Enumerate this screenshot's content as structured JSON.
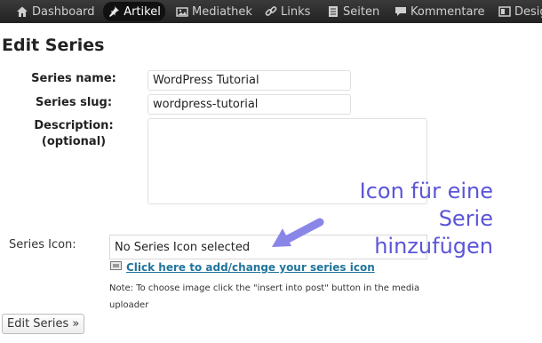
{
  "adminbar": {
    "items": [
      {
        "label": "Dashboard",
        "icon": "home-icon"
      },
      {
        "label": "Artikel",
        "icon": "pin-icon",
        "active": true
      },
      {
        "label": "Mediathek",
        "icon": "media-icon"
      },
      {
        "label": "Links",
        "icon": "link-icon"
      },
      {
        "label": "Seiten",
        "icon": "page-icon"
      },
      {
        "label": "Kommentare",
        "icon": "comment-icon"
      },
      {
        "label": "Design",
        "icon": "design-icon"
      }
    ]
  },
  "page": {
    "title": "Edit Series"
  },
  "form": {
    "name_label": "Series name:",
    "name_value": "WordPress Tutorial",
    "slug_label": "Series slug:",
    "slug_value": "wordpress-tutorial",
    "description_label_line1": "Description:",
    "description_label_line2": "(optional)",
    "description_value": "",
    "icon_label": "Series Icon:",
    "icon_status": "No Series Icon selected",
    "icon_link": "Click here to add/change your series icon",
    "note": "Note: To choose image click the \"insert into post\" button in the media uploader",
    "submit_label": "Edit Series »"
  },
  "annotation": {
    "line1": "Icon für eine Serie",
    "line2": "hinzufügen",
    "color": "#5b55d8",
    "arrow_color": "#8a86e8"
  },
  "colors": {
    "adminbar_bg": "#2d2d2d",
    "link": "#21759b"
  }
}
